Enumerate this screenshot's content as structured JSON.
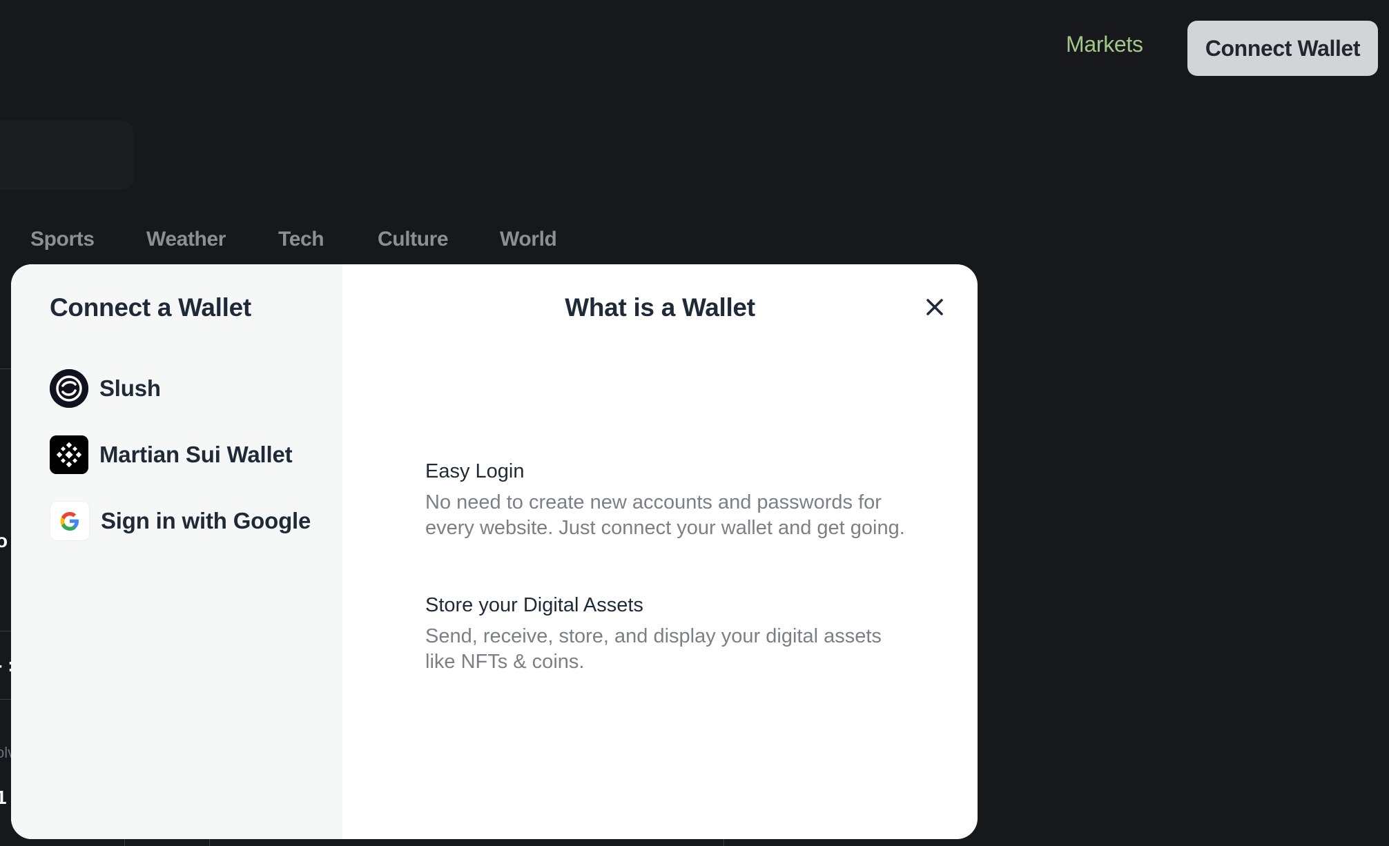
{
  "nav": {
    "markets_label": "Markets",
    "connect_label": "Connect Wallet"
  },
  "categories": [
    "Sports",
    "Weather",
    "Tech",
    "Culture",
    "World"
  ],
  "background_fragments": {
    "frag1": "o",
    "frag2": "- :",
    "frag3": "olv",
    "frag4": "1"
  },
  "modal": {
    "left_title": "Connect a Wallet",
    "wallets": [
      {
        "label": "Slush",
        "icon": "slush-icon"
      },
      {
        "label": "Martian Sui Wallet",
        "icon": "martian-icon"
      },
      {
        "label": "Sign in with Google",
        "icon": "google-icon"
      }
    ],
    "right_title": "What is a Wallet",
    "info": [
      {
        "title": "Easy Login",
        "desc": "No need to create new accounts and passwords for every website. Just connect your wallet and get going."
      },
      {
        "title": "Store your Digital Assets",
        "desc": "Send, receive, store, and display your digital assets like NFTs & coins."
      }
    ]
  },
  "colors": {
    "background": "#17181c",
    "accent_green": "#a3c78a",
    "button_bg": "#d2d4d7"
  }
}
